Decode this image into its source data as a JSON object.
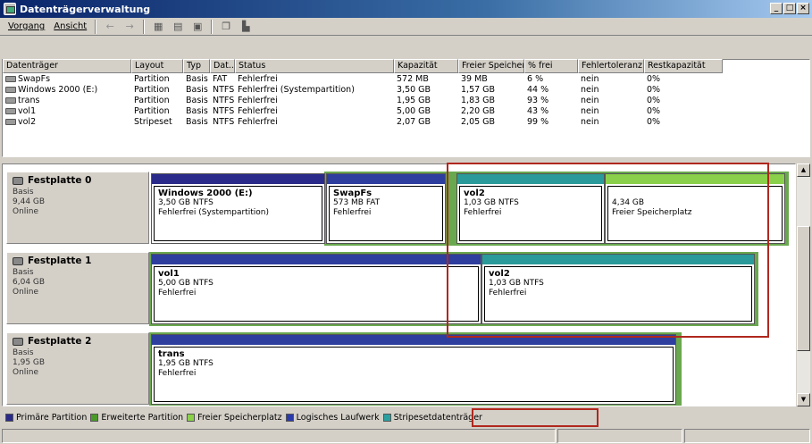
{
  "window": {
    "title": "Datenträgerverwaltung"
  },
  "menu": {
    "items": [
      "Vorgang",
      "Ansicht"
    ]
  },
  "toolbar": {
    "icons": [
      "back-arrow-icon",
      "forward-arrow-icon",
      "disk-view-icon",
      "list-view-icon",
      "properties-icon",
      "help-icon",
      "wizard-icon"
    ]
  },
  "volumes": {
    "columns": [
      "Datenträger",
      "Layout",
      "Typ",
      "Dat...",
      "Status",
      "Kapazität",
      "Freier Speicher",
      "% frei",
      "Fehlertoleranz",
      "Restkapazität"
    ],
    "rows": [
      [
        "SwapFs",
        "Partition",
        "Basis",
        "FAT",
        "Fehlerfrei",
        "572 MB",
        "39 MB",
        "6 %",
        "nein",
        "0%"
      ],
      [
        "Windows 2000 (E:)",
        "Partition",
        "Basis",
        "NTFS",
        "Fehlerfrei (Systempartition)",
        "3,50 GB",
        "1,57 GB",
        "44 %",
        "nein",
        "0%"
      ],
      [
        "trans",
        "Partition",
        "Basis",
        "NTFS",
        "Fehlerfrei",
        "1,95 GB",
        "1,83 GB",
        "93 %",
        "nein",
        "0%"
      ],
      [
        "vol1",
        "Partition",
        "Basis",
        "NTFS",
        "Fehlerfrei",
        "5,00 GB",
        "2,20 GB",
        "43 %",
        "nein",
        "0%"
      ],
      [
        "vol2",
        "Stripeset",
        "Basis",
        "NTFS",
        "Fehlerfrei",
        "2,07 GB",
        "2,05 GB",
        "99 %",
        "nein",
        "0%"
      ]
    ]
  },
  "disks": [
    {
      "name": "Festplatte 0",
      "type": "Basis",
      "size": "9,44 GB",
      "status": "Online",
      "partitions": [
        {
          "name": "Windows 2000  (E:)",
          "size": "3,50 GB NTFS",
          "status": "Fehlerfrei (Systempartition)",
          "kind": "primary"
        },
        {
          "name": "SwapFs",
          "size": "573 MB FAT",
          "status": "Fehlerfrei",
          "kind": "logical"
        },
        {
          "name": "vol2",
          "size": "1,03 GB NTFS",
          "status": "Fehlerfrei",
          "kind": "stripe"
        },
        {
          "name": "",
          "size": "4,34 GB",
          "status": "Freier Speicherplatz",
          "kind": "free"
        }
      ]
    },
    {
      "name": "Festplatte 1",
      "type": "Basis",
      "size": "6,04 GB",
      "status": "Online",
      "partitions": [
        {
          "name": "vol1",
          "size": "5,00 GB NTFS",
          "status": "Fehlerfrei",
          "kind": "logical"
        },
        {
          "name": "vol2",
          "size": "1,03 GB NTFS",
          "status": "Fehlerfrei",
          "kind": "stripe"
        }
      ]
    },
    {
      "name": "Festplatte 2",
      "type": "Basis",
      "size": "1,95 GB",
      "status": "Online",
      "partitions": [
        {
          "name": "trans",
          "size": "1,95 GB NTFS",
          "status": "Fehlerfrei",
          "kind": "logical"
        }
      ]
    }
  ],
  "legend": [
    {
      "label": "Primäre Partition",
      "color": "#2a2a8a"
    },
    {
      "label": "Erweiterte Partition",
      "color": "#4a9a2a"
    },
    {
      "label": "Freier Speicherplatz",
      "color": "#8ad04a"
    },
    {
      "label": "Logisches Laufwerk",
      "color": "#2a3aaa"
    },
    {
      "label": "Stripesetdatenträger",
      "color": "#2aa0a0"
    }
  ],
  "colors": {
    "primary": "#2a2a8a",
    "extended": "#6aa84f",
    "free": "#8ad04a",
    "logical": "#2d3e9e",
    "stripe": "#2a9a9a",
    "highlight": "#b0281e"
  }
}
